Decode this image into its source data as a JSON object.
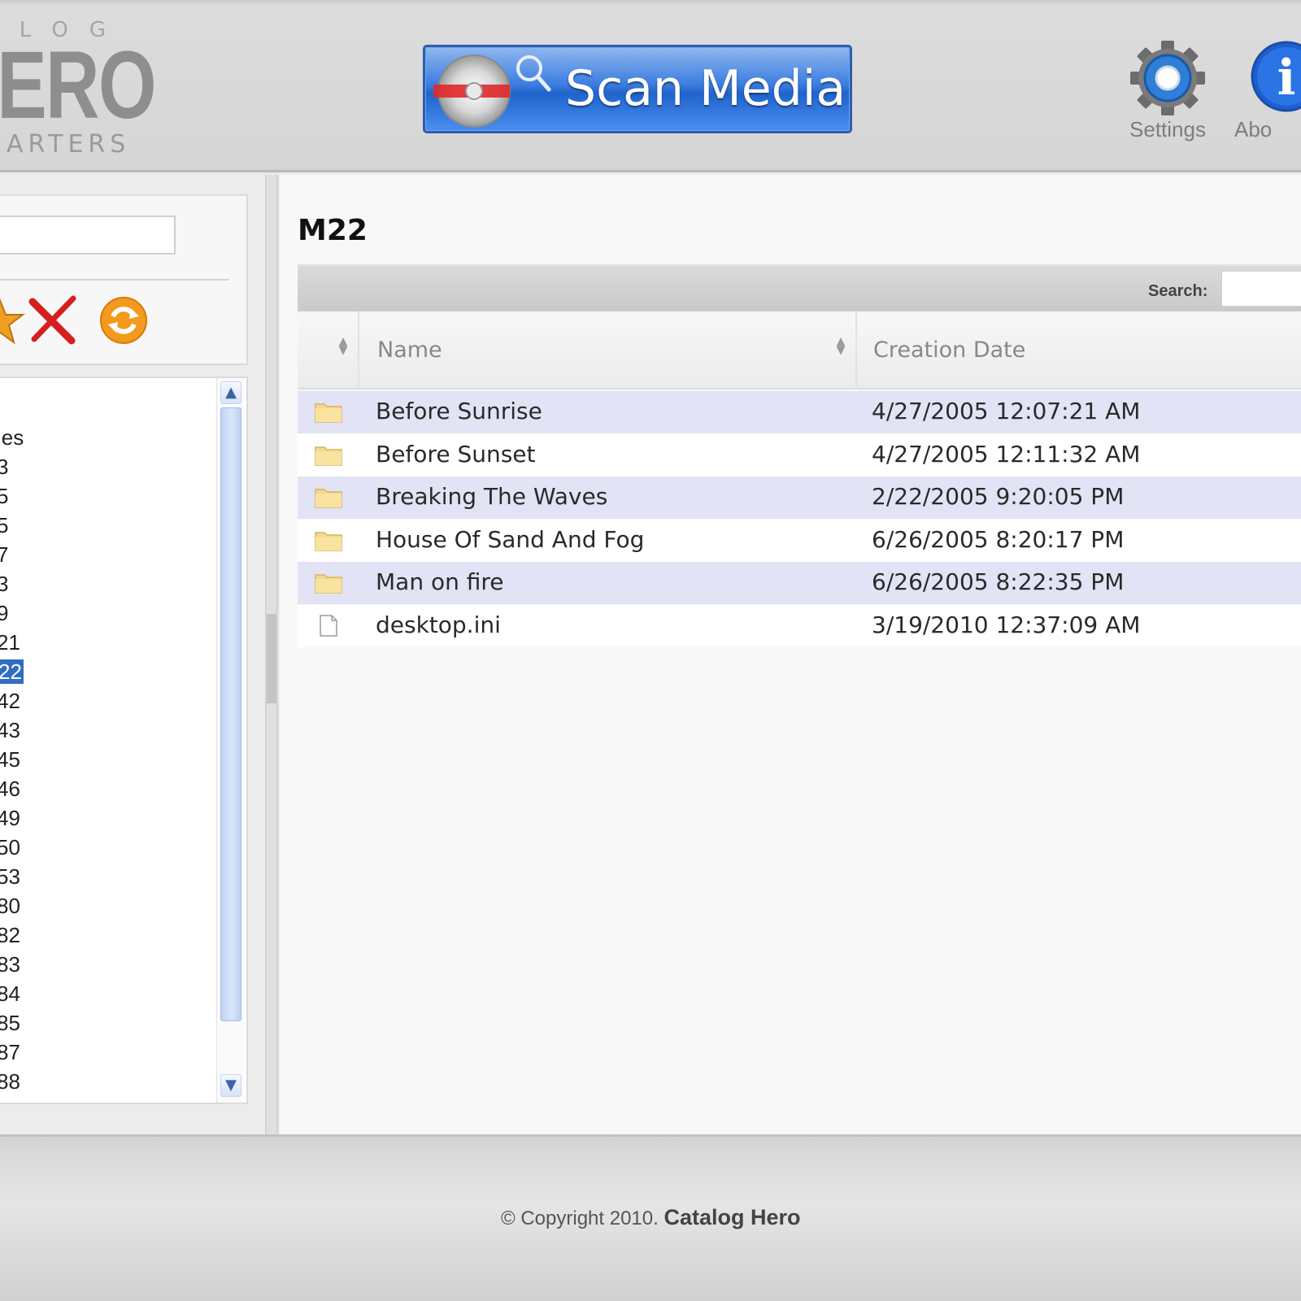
{
  "header": {
    "logo": {
      "line1": "ALOG",
      "line2": "ERO",
      "line3": "UARTERS"
    },
    "scan_button_label": "Scan Media",
    "settings_label": "Settings",
    "about_label": "Abo"
  },
  "sidebar": {
    "search_value": "",
    "tree_items": [
      {
        "label": "ies",
        "selected": false
      },
      {
        "label": "3",
        "selected": false
      },
      {
        "label": "5",
        "selected": false
      },
      {
        "label": "5",
        "selected": false
      },
      {
        "label": "7",
        "selected": false
      },
      {
        "label": "3",
        "selected": false
      },
      {
        "label": "9",
        "selected": false
      },
      {
        "label": "21",
        "selected": false
      },
      {
        "label": "22",
        "selected": true
      },
      {
        "label": "42",
        "selected": false
      },
      {
        "label": "43",
        "selected": false
      },
      {
        "label": "45",
        "selected": false
      },
      {
        "label": "46",
        "selected": false
      },
      {
        "label": "49",
        "selected": false
      },
      {
        "label": "50",
        "selected": false
      },
      {
        "label": "53",
        "selected": false
      },
      {
        "label": "80",
        "selected": false
      },
      {
        "label": "82",
        "selected": false
      },
      {
        "label": "83",
        "selected": false
      },
      {
        "label": "84",
        "selected": false
      },
      {
        "label": "85",
        "selected": false
      },
      {
        "label": "87",
        "selected": false
      },
      {
        "label": "88",
        "selected": false
      }
    ]
  },
  "main": {
    "folder_title": "M22",
    "search_label": "Search:",
    "search_value": "",
    "columns": {
      "name": "Name",
      "creation_date": "Creation Date"
    },
    "rows": [
      {
        "type": "folder",
        "name": "Before Sunrise",
        "date": "4/27/2005 12:07:21 AM"
      },
      {
        "type": "folder",
        "name": "Before Sunset",
        "date": "4/27/2005 12:11:32 AM"
      },
      {
        "type": "folder",
        "name": "Breaking The Waves",
        "date": "2/22/2005 9:20:05 PM"
      },
      {
        "type": "folder",
        "name": "House Of Sand And Fog",
        "date": "6/26/2005 8:20:17 PM"
      },
      {
        "type": "folder",
        "name": "Man on fire",
        "date": "6/26/2005 8:22:35 PM"
      },
      {
        "type": "file",
        "name": "desktop.ini",
        "date": "3/19/2010 12:37:09 AM"
      }
    ]
  },
  "footer": {
    "copyright": "© Copyright 2010.",
    "brand": "Catalog Hero"
  },
  "colors": {
    "accent": "#2f6ec0",
    "row_alt": "#e3e3f6",
    "scan_button": "#3b7de0"
  },
  "icons": [
    "cd-scan-icon",
    "gear-icon",
    "info-icon",
    "add-star-icon",
    "delete-x-icon",
    "refresh-icon",
    "folder-icon",
    "file-icon"
  ]
}
